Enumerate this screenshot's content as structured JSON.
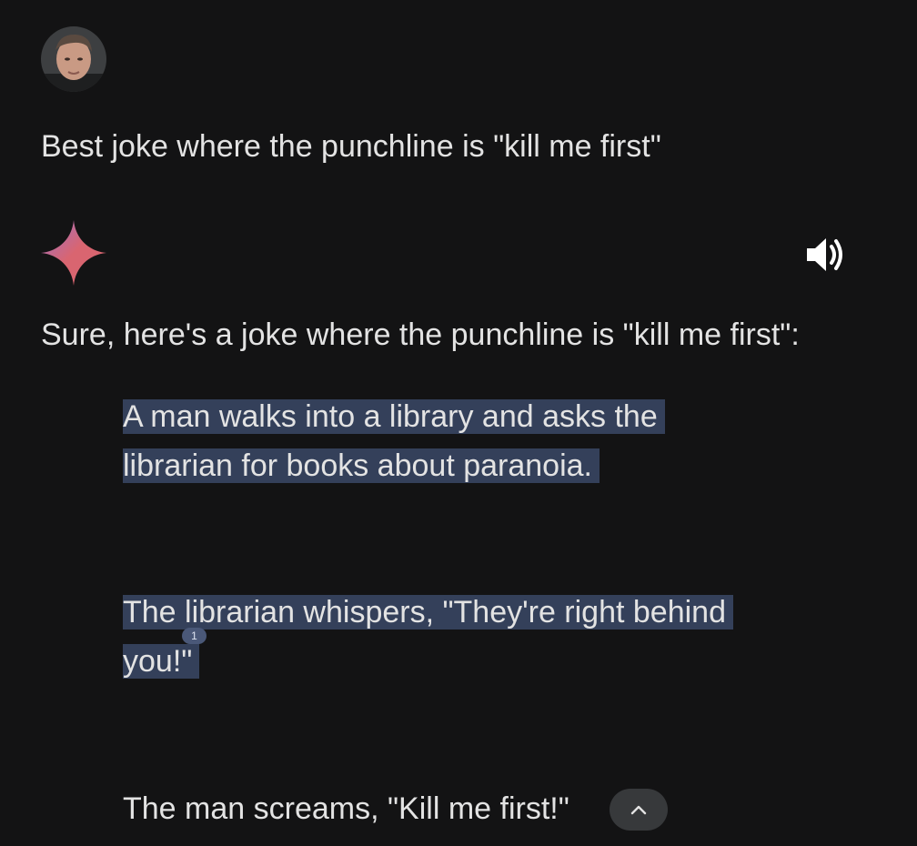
{
  "user": {
    "avatar_icon": "user-avatar-photo"
  },
  "prompt": {
    "text": "Best joke where the punchline is \"kill me first\""
  },
  "response": {
    "model_icon": "gemini-sparkle-icon",
    "listen_icon": "speaker-icon",
    "intro": "Sure, here's a joke where the punchline is \"kill me first\":",
    "paragraphs": {
      "p1_line1": "A man walks into a library and asks the",
      "p1_line2": "librarian for books about paranoia.",
      "p2_line1": "The librarian whispers, \"They're right behind",
      "p2_line2": "you!\"",
      "p3": "The man screams, \"Kill me first!\""
    },
    "citation": "1",
    "collapse_icon": "chevron-up-icon"
  },
  "colors": {
    "background": "#131314",
    "text": "#e3e3e3",
    "highlight": "#34405a",
    "chip": "#37393b",
    "sparkle_start": "#4f8ff7",
    "sparkle_mid": "#d96570",
    "sparkle_end": "#9b72cb"
  }
}
